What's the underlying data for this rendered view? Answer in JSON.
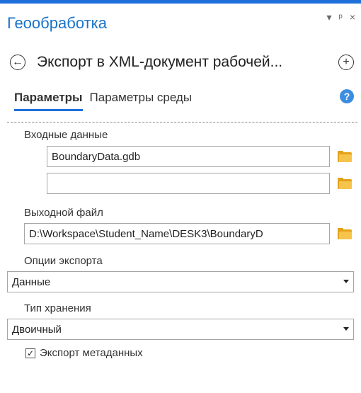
{
  "pane": {
    "title": "Геообработка",
    "controls": {
      "menu": "▾",
      "pin": "ᵖ",
      "close": "×"
    }
  },
  "tool": {
    "back_icon": "←",
    "title": "Экспорт в XML-документ рабочей...",
    "add_icon": "+"
  },
  "tabs": [
    {
      "label": "Параметры",
      "active": true
    },
    {
      "label": "Параметры среды",
      "active": false
    }
  ],
  "help_icon": "?",
  "params": {
    "input_label": "Входные данные",
    "input_values": [
      "BoundaryData.gdb",
      ""
    ],
    "output_label": "Выходной файл",
    "output_value": "D:\\Workspace\\Student_Name\\DESK3\\BoundaryD",
    "export_options_label": "Опции экспорта",
    "export_options_value": "Данные",
    "storage_type_label": "Тип хранения",
    "storage_type_value": "Двоичный",
    "export_metadata_label": "Экспорт метаданных",
    "export_metadata_checked": true
  },
  "colors": {
    "accent": "#1e6fd9",
    "title": "#1a73c9",
    "folder": "#e3a21a"
  }
}
